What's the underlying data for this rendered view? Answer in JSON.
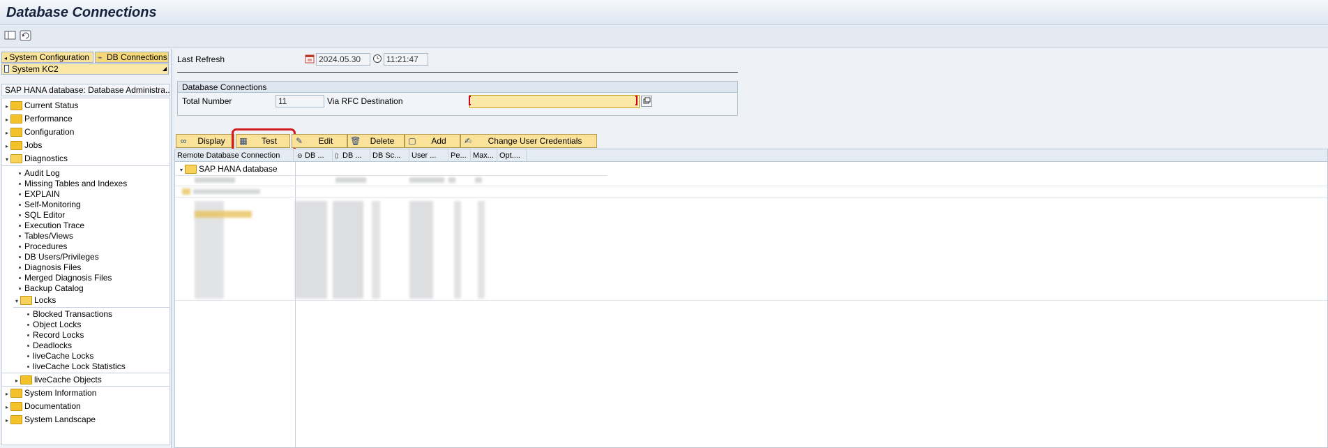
{
  "title": "Database Connections",
  "toolbar": {
    "icons": [
      "panel-toggle-icon",
      "refresh-icon"
    ]
  },
  "left_panel": {
    "tabs": [
      "System Configuration",
      "DB Connections"
    ],
    "system": "System KC2",
    "tree_header": "SAP HANA database: Database Administra...",
    "tree": {
      "current_status": "Current Status",
      "performance": "Performance",
      "configuration": "Configuration",
      "jobs": "Jobs",
      "diagnostics": "Diagnostics",
      "diag_items": [
        "Audit Log",
        "Missing Tables and Indexes",
        "EXPLAIN",
        "Self-Monitoring",
        "SQL Editor",
        "Execution Trace",
        "Tables/Views",
        "Procedures",
        "DB Users/Privileges",
        "Diagnosis Files",
        "Merged Diagnosis Files",
        "Backup Catalog"
      ],
      "locks": "Locks",
      "lock_items": [
        "Blocked Transactions",
        "Object Locks",
        "Record Locks",
        "Deadlocks",
        "liveCache Locks",
        "liveCache Lock Statistics"
      ],
      "livecache_objects": "liveCache Objects",
      "system_information": "System Information",
      "documentation": "Documentation",
      "system_landscape": "System Landscape"
    }
  },
  "main": {
    "last_refresh_label": "Last Refresh",
    "last_refresh_date": "2024.05.30",
    "last_refresh_time": "11:21:47",
    "db_group_title": "Database Connections",
    "total_number_label": "Total Number",
    "total_number_value": "11",
    "rfc_label": "Via RFC Destination",
    "rfc_value": "",
    "buttons": {
      "display": "Display",
      "test": "Test",
      "edit": "Edit",
      "delete": "Delete",
      "add": "Add",
      "change_credentials": "Change User Credentials"
    },
    "grid": {
      "columns": [
        "Remote Database Connection",
        "DB ...",
        "DB ...",
        "DB Sc...",
        "User ...",
        "Pe...",
        "Max...",
        "Opt...."
      ],
      "root_node": "SAP HANA database"
    }
  },
  "colors": {
    "highlight": "#d71920",
    "button_bg": "#fbe29a",
    "selected": "#fbe8a7"
  }
}
